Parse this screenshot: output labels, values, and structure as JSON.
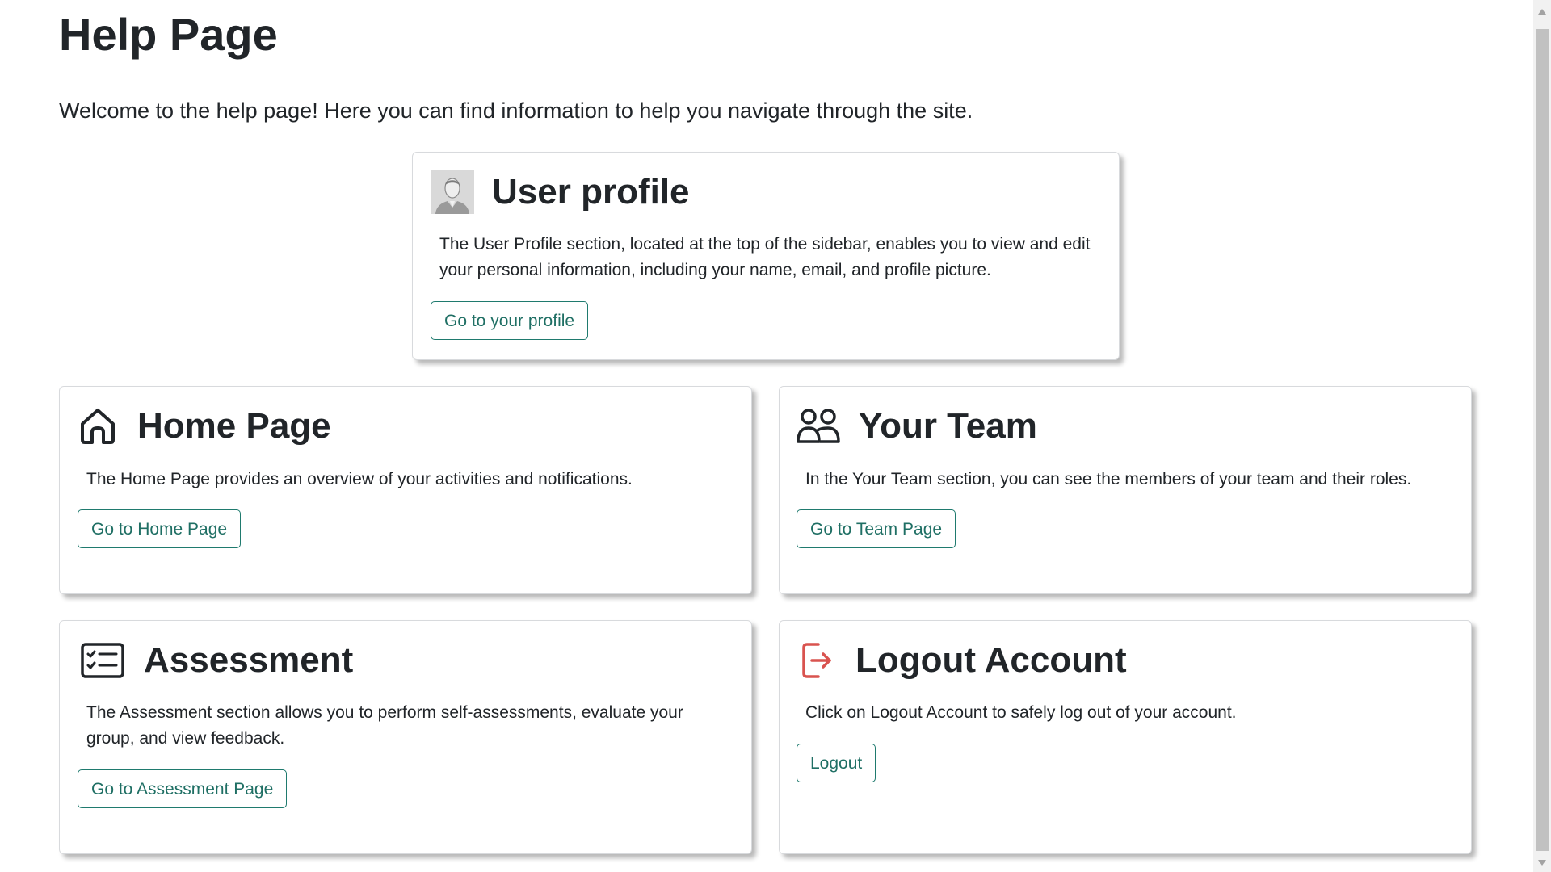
{
  "page": {
    "title": "Help Page",
    "intro": "Welcome to the help page! Here you can find information to help you navigate through the site."
  },
  "cards": {
    "profile": {
      "title": "User profile",
      "text": "The User Profile section, located at the top of the sidebar, enables you to view and edit your personal information, including your name, email, and profile picture.",
      "button": "Go to your profile",
      "icon": "user-avatar-icon"
    },
    "home": {
      "title": "Home Page",
      "text": "The Home Page provides an overview of your activities and notifications.",
      "button": "Go to Home Page",
      "icon": "house-icon"
    },
    "team": {
      "title": "Your Team",
      "text": "In the Your Team section, you can see the members of your team and their roles.",
      "button": "Go to Team Page",
      "icon": "people-icon"
    },
    "assessment": {
      "title": "Assessment",
      "text": "The Assessment section allows you to perform self-assessments, evaluate your group, and view feedback.",
      "button": "Go to Assessment Page",
      "icon": "checklist-icon"
    },
    "logout": {
      "title": "Logout Account",
      "text": "Click on Logout Account to safely log out of your account.",
      "button": "Logout",
      "icon": "logout-icon"
    }
  },
  "colors": {
    "button_border": "#1f7a6e",
    "button_text": "#1f6f64",
    "logout_icon": "#d9534f",
    "text": "#212529"
  }
}
